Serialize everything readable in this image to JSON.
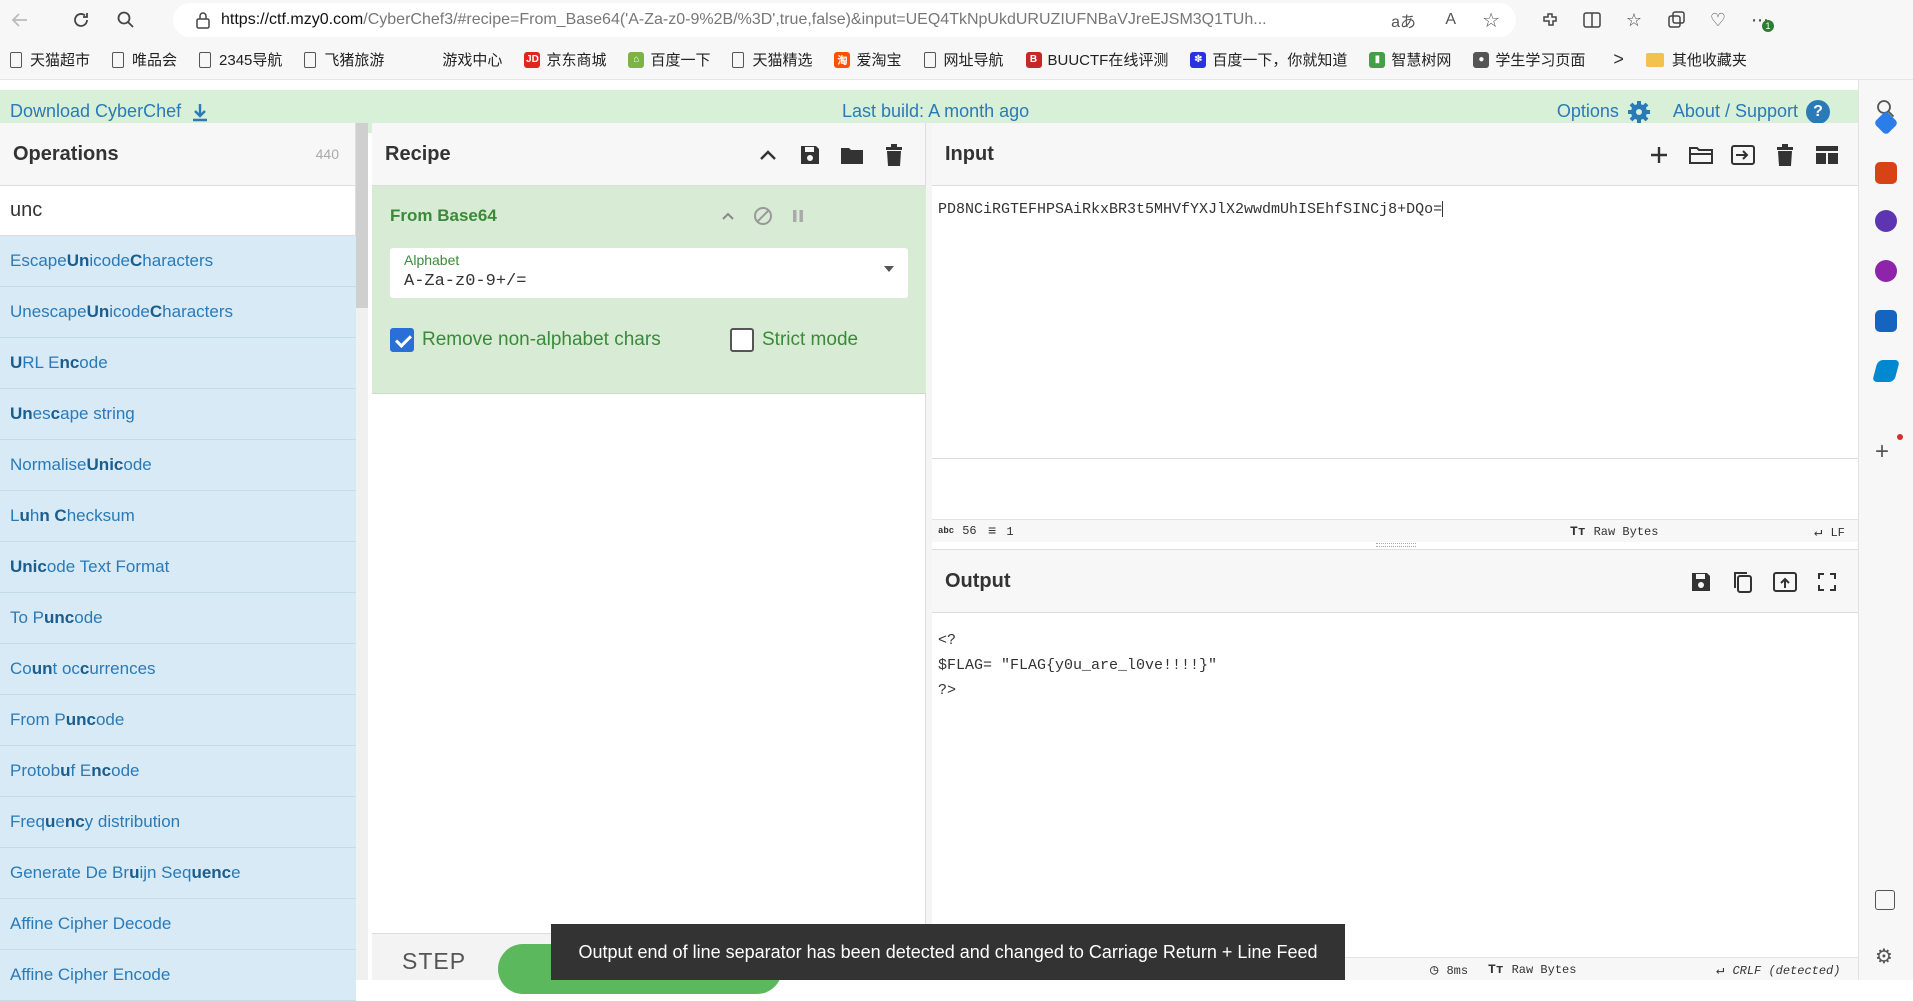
{
  "browser": {
    "url_host": "https://ctf.mzy0.com",
    "url_path": "/CyberChef3/#recipe=From_Base64('A-Za-z0-9%2B/%3D',true,false)&input=UEQ4TkNpUkdURUZIUFNBaVJreEJSM3Q1TUh...",
    "translate_glyph": "aあ",
    "read_aloud_glyph": "A",
    "ext_badge": "1"
  },
  "bookmarks": [
    {
      "label": "天猫超市",
      "icon": "file",
      "color": "#555"
    },
    {
      "label": "唯品会",
      "icon": "file",
      "color": "#555"
    },
    {
      "label": "2345导航",
      "icon": "file",
      "color": "#555"
    },
    {
      "label": "飞猪旅游",
      "icon": "file",
      "color": "#555"
    },
    {
      "label": "游戏中心",
      "icon": "none",
      "color": "#555"
    },
    {
      "label": "京东商城",
      "icon": "badge",
      "color": "#e1251b",
      "glyph": "JD"
    },
    {
      "label": "百度一下",
      "icon": "badge",
      "color": "#7cb342",
      "glyph": "⌂"
    },
    {
      "label": "天猫精选",
      "icon": "file",
      "color": "#555"
    },
    {
      "label": "爱淘宝",
      "icon": "badge",
      "color": "#ff5000",
      "glyph": "淘"
    },
    {
      "label": "网址导航",
      "icon": "file",
      "color": "#555"
    },
    {
      "label": "BUUCTF在线评测",
      "icon": "badge",
      "color": "#c62828",
      "glyph": "B"
    },
    {
      "label": "百度一下，你就知道",
      "icon": "badge",
      "color": "#2932e1",
      "glyph": "✽"
    },
    {
      "label": "智慧树网",
      "icon": "badge",
      "color": "#43a047",
      "glyph": "▮"
    },
    {
      "label": "学生学习页面",
      "icon": "badge",
      "color": "#555",
      "glyph": "●"
    }
  ],
  "bookmarks_more": ">",
  "other_favorites": "其他收藏夹",
  "banner": {
    "download": "Download CyberChef",
    "last_build": "Last build: A month ago",
    "options": "Options",
    "about": "About / Support",
    "help_glyph": "?"
  },
  "operations": {
    "title": "Operations",
    "count": "440",
    "search_value": "unc",
    "items": [
      {
        "pre": "Escape ",
        "b1": "Un",
        "mid": "icode ",
        "b2": "C",
        "post": "haracters"
      },
      {
        "pre": "Unescape ",
        "b1": "Un",
        "mid": "icode ",
        "b2": "C",
        "post": "haracters"
      },
      {
        "pre": "",
        "b1": "U",
        "mid": "RL E",
        "b2": "nc",
        "post": "ode"
      },
      {
        "pre": "",
        "b1": "Un",
        "mid": "es",
        "b2": "c",
        "post": "ape string"
      },
      {
        "pre": "Normalise ",
        "b1": "Unic",
        "mid": "ode",
        "b2": "",
        "post": ""
      },
      {
        "pre": "L",
        "b1": "u",
        "mid": "h",
        "b2": "n C",
        "post": "hecksum"
      },
      {
        "pre": "",
        "b1": "Unic",
        "mid": "ode Text Format",
        "b2": "",
        "post": ""
      },
      {
        "pre": "To P",
        "b1": "unc",
        "mid": "ode",
        "b2": "",
        "post": ""
      },
      {
        "pre": "Co",
        "b1": "un",
        "mid": "t oc",
        "b2": "c",
        "post": "urrences"
      },
      {
        "pre": "From P",
        "b1": "unc",
        "mid": "ode",
        "b2": "",
        "post": ""
      },
      {
        "pre": "Protob",
        "b1": "u",
        "mid": "f E",
        "b2": "nc",
        "post": "ode"
      },
      {
        "pre": "Freq",
        "b1": "u",
        "mid": "e",
        "b2": "nc",
        "post": "y distribution"
      },
      {
        "pre": "Generate De Br",
        "b1": "u",
        "mid": "ijn Seq",
        "b2": "uenc",
        "post": "e"
      },
      {
        "pre": "Affine Cipher Decode",
        "b1": "",
        "mid": "",
        "b2": "",
        "post": ""
      },
      {
        "pre": "Affine Cipher Encode",
        "b1": "",
        "mid": "",
        "b2": "",
        "post": ""
      }
    ]
  },
  "recipe": {
    "title": "Recipe",
    "op_name": "From Base64",
    "alphabet_label": "Alphabet",
    "alphabet_value": "A-Za-z0-9+/=",
    "remove_non_alpha": "Remove non-alphabet chars",
    "remove_non_alpha_checked": true,
    "strict_mode": "Strict mode",
    "strict_mode_checked": false,
    "step": "STEP"
  },
  "input": {
    "title": "Input",
    "text": "PD8NCiRGTEFHPSAiRkxBR3t5MHVfYXJlX2wwdmUhISEhfSINCj8+DQo=",
    "length_glyph": "abc",
    "length": "56",
    "lines": "1",
    "encoding": "Raw Bytes",
    "eol": "LF"
  },
  "output": {
    "title": "Output",
    "lines": [
      "<?",
      "$FLAG= \"FLAG{y0u_are_l0ve!!!!}\"",
      "?>"
    ],
    "time": "8ms",
    "encoding": "Raw Bytes",
    "eol": "CRLF (detected)"
  },
  "toast": "Output end of line separator has been detected and changed to Carriage Return + Line Feed",
  "colors": {
    "accent": "#2a7ab8",
    "banner_bg": "#d8f0d7",
    "op_highlight": "#d7eaf5",
    "recipe_op_bg": "#d8ecd5",
    "bake_green": "#5cb85c"
  }
}
